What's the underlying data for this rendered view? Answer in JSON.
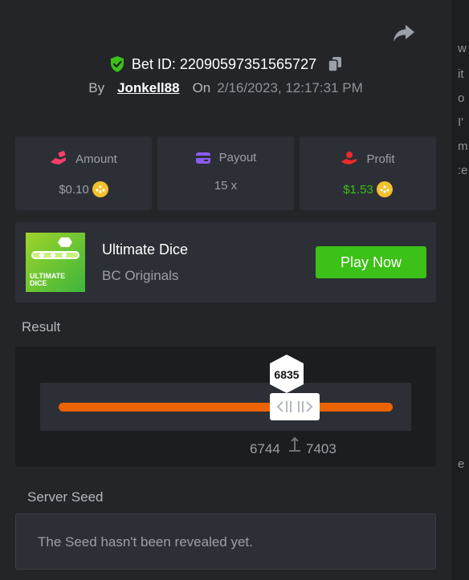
{
  "background_page": {
    "fragments": [
      "w",
      "it",
      "o",
      "I'",
      "m",
      ":e",
      "e"
    ]
  },
  "bet": {
    "id_label": "Bet ID: 22090597351565727",
    "by_label": "By",
    "username": "Jonkell88",
    "on_label": "On",
    "datetime": "2/16/2023, 12:17:31 PM"
  },
  "stats": {
    "amount": {
      "label": "Amount",
      "value": "$0.10"
    },
    "payout": {
      "label": "Payout",
      "value": "15 x"
    },
    "profit": {
      "label": "Profit",
      "value": "$1.53"
    }
  },
  "game": {
    "name": "Ultimate Dice",
    "provider": "BC Originals",
    "play_label": "Play Now",
    "thumb_text_line1": "ULTIMATE",
    "thumb_text_line2": "DICE"
  },
  "result": {
    "label": "Result",
    "rolled": "6835",
    "range_low": "6744",
    "range_high": "7403"
  },
  "server_seed": {
    "label": "Server Seed",
    "text": "The Seed hasn't been revealed yet."
  },
  "colors": {
    "background": "#232529",
    "card": "#2c2f35",
    "accent_green": "#3bc117",
    "track_orange": "#ed6300",
    "coin_gold": "#f2c12e"
  },
  "icons": {
    "share": "share-arrow-icon",
    "verified": "shield-check-icon",
    "copy": "copy-icon",
    "amount": "money-hand-icon",
    "payout": "wallet-card-icon",
    "profit": "profit-hand-icon",
    "coin": "coin-icon"
  }
}
